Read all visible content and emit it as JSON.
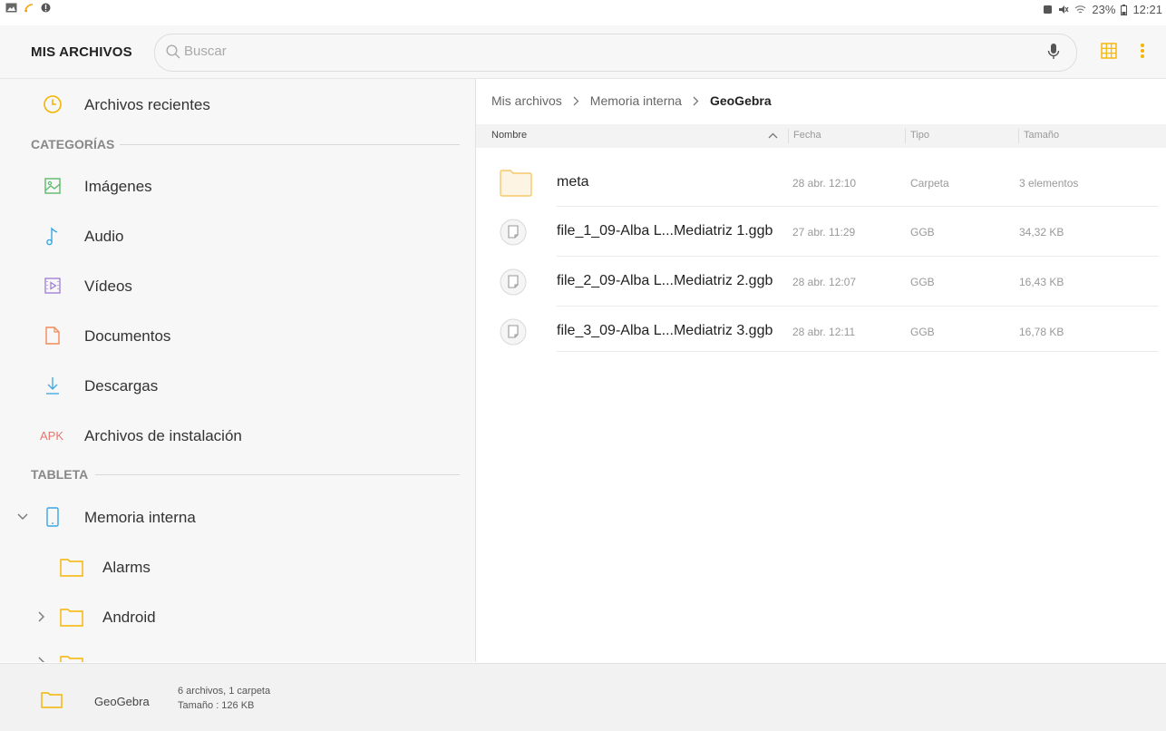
{
  "status_bar": {
    "battery": "23%",
    "time": "12:21"
  },
  "header": {
    "title": "MIS ARCHIVOS",
    "search_placeholder": "Buscar"
  },
  "sidebar": {
    "recent": "Archivos recientes",
    "categories_label": "CATEGORÍAS",
    "categories": [
      {
        "label": "Imágenes",
        "icon": "image-icon"
      },
      {
        "label": "Audio",
        "icon": "music-note-icon"
      },
      {
        "label": "Vídeos",
        "icon": "video-icon"
      },
      {
        "label": "Documentos",
        "icon": "document-icon"
      },
      {
        "label": "Descargas",
        "icon": "download-icon"
      },
      {
        "label": "Archivos de instalación",
        "icon": "apk-icon",
        "icon_text": "APK"
      }
    ],
    "tablet_label": "TABLETA",
    "tablet_items": [
      {
        "label": "Memoria interna"
      },
      {
        "label": "Alarms"
      },
      {
        "label": "Android"
      }
    ]
  },
  "breadcrumb": {
    "root": "Mis archivos",
    "middle": "Memoria interna",
    "current": "GeoGebra"
  },
  "columns": {
    "name": "Nombre",
    "date": "Fecha",
    "type": "Tipo",
    "size": "Tamaño"
  },
  "files": [
    {
      "name": "meta",
      "date": "28 abr. 12:10",
      "type": "Carpeta",
      "size": "3 elementos",
      "kind": "folder"
    },
    {
      "name": "file_1_09-Alba L...Mediatriz 1.ggb",
      "date": "27 abr. 11:29",
      "type": "GGB",
      "size": "34,32 KB",
      "kind": "file"
    },
    {
      "name": "file_2_09-Alba L...Mediatriz 2.ggb",
      "date": "28 abr. 12:07",
      "type": "GGB",
      "size": "16,43 KB",
      "kind": "file"
    },
    {
      "name": "file_3_09-Alba L...Mediatriz 3.ggb",
      "date": "28 abr. 12:11",
      "type": "GGB",
      "size": "16,78 KB",
      "kind": "file"
    }
  ],
  "bottom_bar": {
    "folder": "GeoGebra",
    "summary": "6 archivos, 1 carpeta",
    "size": "Tamaño : 126 KB"
  },
  "colors": {
    "accent": "#f5b400",
    "folder": "#f7c768",
    "background": "#f7f7f7"
  }
}
